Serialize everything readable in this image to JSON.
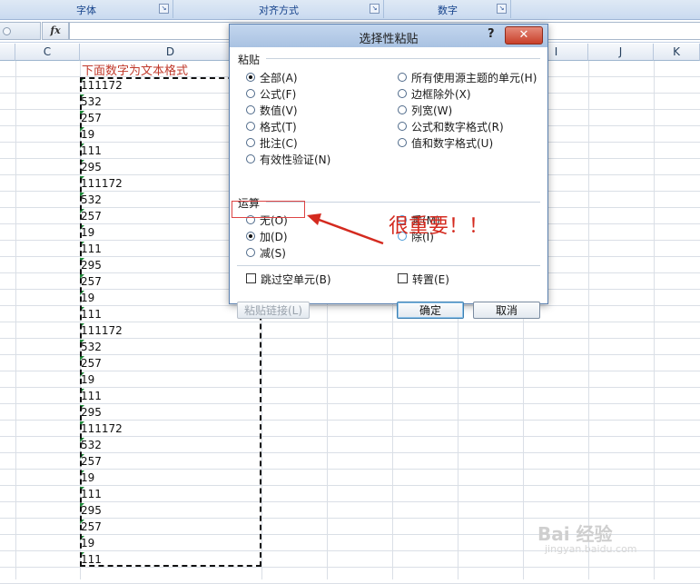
{
  "ribbon": {
    "groups": [
      {
        "label": "字体"
      },
      {
        "label": "对齐方式"
      },
      {
        "label": "数字"
      },
      {
        "label": ""
      }
    ]
  },
  "formula_bar": {
    "fx_label": "fx",
    "value": ""
  },
  "columns": [
    "C",
    "D",
    "I",
    "J",
    "K"
  ],
  "sheet": {
    "header_text": "下面数字为文本格式",
    "values": [
      "111172",
      "532",
      "257",
      "19",
      "111",
      "295",
      "111172",
      "532",
      "257",
      "19",
      "111",
      "295",
      "257",
      "19",
      "111",
      "111172",
      "532",
      "257",
      "19",
      "111",
      "295",
      "111172",
      "532",
      "257",
      "19",
      "111",
      "295",
      "257",
      "19",
      "111"
    ]
  },
  "dialog": {
    "title": "选择性粘贴",
    "help": "?",
    "close": "✕",
    "paste_section": "粘贴",
    "paste_options_left": [
      "全部(A)",
      "公式(F)",
      "数值(V)",
      "格式(T)",
      "批注(C)",
      "有效性验证(N)"
    ],
    "paste_options_right": [
      "所有使用源主题的单元(H)",
      "边框除外(X)",
      "列宽(W)",
      "公式和数字格式(R)",
      "值和数字格式(U)"
    ],
    "paste_selected": "全部(A)",
    "operation_section": "运算",
    "operation_options_left": [
      "无(O)",
      "加(D)",
      "减(S)"
    ],
    "operation_options_right": [
      "乘(M)",
      "除(I)"
    ],
    "operation_selected": "加(D)",
    "skip_blanks": "跳过空单元(B)",
    "transpose": "转置(E)",
    "paste_link": "粘贴链接(L)",
    "ok": "确定",
    "cancel": "取消"
  },
  "annotation": "很重要！！",
  "watermark": {
    "line1": "Bai 经验",
    "line2": "jingyan.baidu.com"
  },
  "colors": {
    "annotation_red": "#d42a1f",
    "dialog_title_bg": "#a9c2e2",
    "close_red": "#c8402a"
  }
}
